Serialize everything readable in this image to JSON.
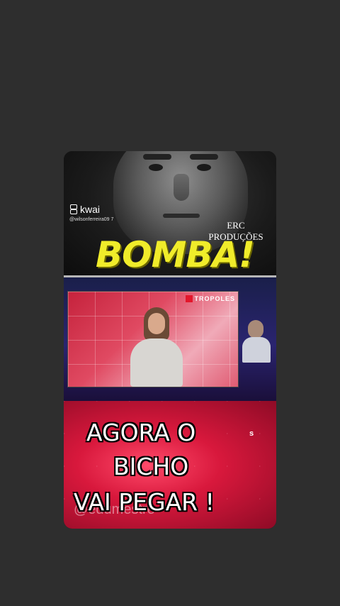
{
  "kwai": {
    "brand": "kwai",
    "handle": "@wilsonferreira09 7"
  },
  "overlay": {
    "producer_line1": "ERC",
    "producer_line2": "PRODUÇÕES",
    "headline": "BOMBA!"
  },
  "news": {
    "logo_text": "TROPOLES"
  },
  "caption": {
    "line1": "AGORA O",
    "line2": "BICHO",
    "line3": "VAI PEGAR !",
    "side_mark": "s",
    "watermark": "@edumestre"
  },
  "colors": {
    "background": "#2e2e2e",
    "headline": "#f0ec2a",
    "caption_bg": "#d8183c"
  }
}
